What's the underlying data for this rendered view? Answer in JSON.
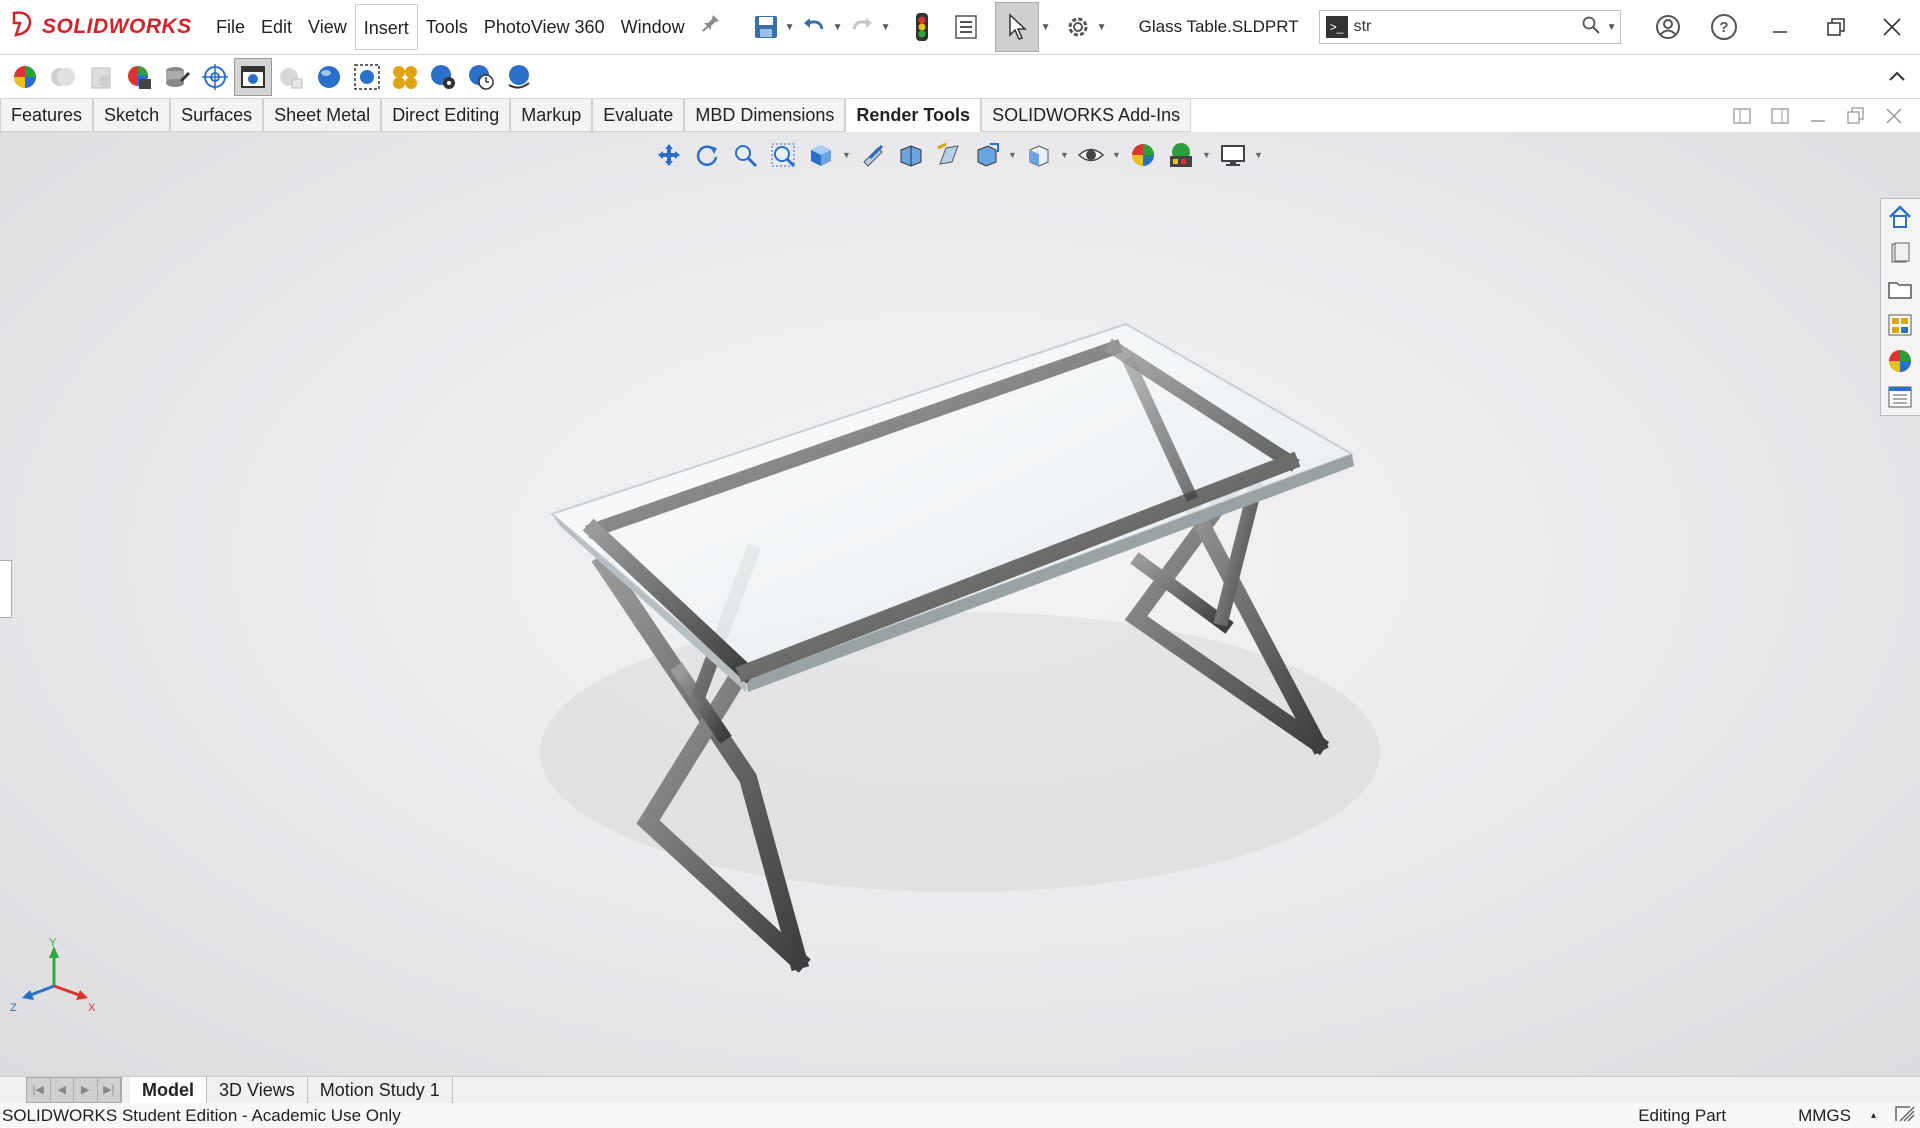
{
  "app": {
    "logo_prefix": "3S",
    "logo_text": "SOLIDWORKS"
  },
  "menu": [
    "File",
    "Edit",
    "View",
    "Insert",
    "Tools",
    "PhotoView 360",
    "Window"
  ],
  "menu_active": "Insert",
  "document_title": "Glass Table.SLDPRT",
  "search": {
    "value": "str",
    "placeholder": ""
  },
  "command_tabs": [
    "Features",
    "Sketch",
    "Surfaces",
    "Sheet Metal",
    "Direct Editing",
    "Markup",
    "Evaluate",
    "MBD Dimensions",
    "Render Tools",
    "SOLIDWORKS Add-Ins"
  ],
  "command_tab_active": "Render Tools",
  "triad": {
    "y": "Y",
    "x": "X",
    "z": "Z"
  },
  "bottom_tabs": [
    "Model",
    "3D Views",
    "Motion Study 1"
  ],
  "bottom_tab_active": "Model",
  "status": {
    "edition": "SOLIDWORKS Student Edition - Academic Use Only",
    "mode": "Editing Part",
    "units": "MMGS",
    "units_caret": "▴"
  },
  "colors": {
    "brand": "#d1242a",
    "accent": "#2a6fc9"
  }
}
